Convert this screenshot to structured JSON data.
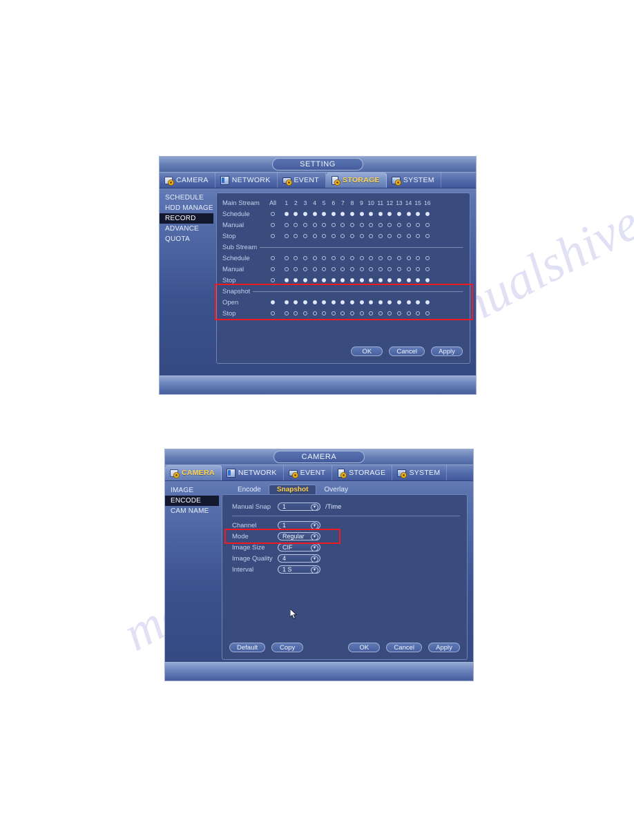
{
  "dialog1": {
    "window_title": "SETTING",
    "tabs": [
      {
        "label": "CAMERA",
        "icon": "camera-icon",
        "active": false
      },
      {
        "label": "NETWORK",
        "icon": "network-icon",
        "active": false
      },
      {
        "label": "EVENT",
        "icon": "event-icon",
        "active": false
      },
      {
        "label": "STORAGE",
        "icon": "storage-icon",
        "active": true
      },
      {
        "label": "SYSTEM",
        "icon": "system-icon",
        "active": false
      }
    ],
    "sidebar": [
      {
        "label": "SCHEDULE",
        "active": false
      },
      {
        "label": "HDD MANAGE",
        "active": false
      },
      {
        "label": "RECORD",
        "active": true
      },
      {
        "label": "ADVANCE",
        "active": false
      },
      {
        "label": "QUOTA",
        "active": false
      }
    ],
    "channel_headers": [
      "1",
      "2",
      "3",
      "4",
      "5",
      "6",
      "7",
      "8",
      "9",
      "10",
      "11",
      "12",
      "13",
      "14",
      "15",
      "16"
    ],
    "all_label": "All",
    "groups": [
      {
        "title": "Main Stream",
        "title_inline": true,
        "rows": [
          {
            "label": "Schedule",
            "all": false,
            "states": [
              true,
              true,
              true,
              true,
              true,
              true,
              true,
              true,
              true,
              true,
              true,
              true,
              true,
              true,
              true,
              true
            ]
          },
          {
            "label": "Manual",
            "all": false,
            "states": [
              false,
              false,
              false,
              false,
              false,
              false,
              false,
              false,
              false,
              false,
              false,
              false,
              false,
              false,
              false,
              false
            ]
          },
          {
            "label": "Stop",
            "all": false,
            "states": [
              false,
              false,
              false,
              false,
              false,
              false,
              false,
              false,
              false,
              false,
              false,
              false,
              false,
              false,
              false,
              false
            ]
          }
        ]
      },
      {
        "title": "Sub Stream",
        "title_inline": false,
        "rows": [
          {
            "label": "Schedule",
            "all": false,
            "states": [
              false,
              false,
              false,
              false,
              false,
              false,
              false,
              false,
              false,
              false,
              false,
              false,
              false,
              false,
              false,
              false
            ]
          },
          {
            "label": "Manual",
            "all": false,
            "states": [
              false,
              false,
              false,
              false,
              false,
              false,
              false,
              false,
              false,
              false,
              false,
              false,
              false,
              false,
              false,
              false
            ]
          },
          {
            "label": "Stop",
            "all": false,
            "states": [
              true,
              true,
              true,
              true,
              true,
              true,
              true,
              true,
              true,
              true,
              true,
              true,
              true,
              true,
              true,
              true
            ]
          }
        ]
      },
      {
        "title": "Snapshot",
        "title_inline": false,
        "rows": [
          {
            "label": "Open",
            "all": true,
            "states": [
              true,
              true,
              true,
              true,
              true,
              true,
              true,
              true,
              true,
              true,
              true,
              true,
              true,
              true,
              true,
              true
            ]
          },
          {
            "label": "Stop",
            "all": false,
            "states": [
              false,
              false,
              false,
              false,
              false,
              false,
              false,
              false,
              false,
              false,
              false,
              false,
              false,
              false,
              false,
              false
            ]
          }
        ]
      }
    ],
    "buttons": [
      {
        "label": "OK"
      },
      {
        "label": "Cancel"
      },
      {
        "label": "Apply"
      }
    ],
    "highlight_color": "#ee1c20"
  },
  "dialog2": {
    "window_title": "CAMERA",
    "tabs": [
      {
        "label": "CAMERA",
        "icon": "camera-icon",
        "active": true
      },
      {
        "label": "NETWORK",
        "icon": "network-icon",
        "active": false
      },
      {
        "label": "EVENT",
        "icon": "event-icon",
        "active": false
      },
      {
        "label": "STORAGE",
        "icon": "storage-icon",
        "active": false
      },
      {
        "label": "SYSTEM",
        "icon": "system-icon",
        "active": false
      }
    ],
    "sidebar": [
      {
        "label": "IMAGE",
        "active": false
      },
      {
        "label": "ENCODE",
        "active": true
      },
      {
        "label": "CAM NAME",
        "active": false
      }
    ],
    "subtabs": [
      {
        "label": "Encode",
        "active": false
      },
      {
        "label": "Snapshot",
        "active": true
      },
      {
        "label": "Overlay",
        "active": false
      }
    ],
    "fields_top": [
      {
        "label": "Manual Snap",
        "value": "1",
        "suffix": "/Time"
      }
    ],
    "fields": [
      {
        "label": "Channel",
        "value": "1"
      },
      {
        "label": "Mode",
        "value": "Regular"
      },
      {
        "label": "Image Size",
        "value": "CIF"
      },
      {
        "label": "Image Quality",
        "value": "4"
      },
      {
        "label": "Interval",
        "value": "1 S"
      }
    ],
    "buttons_left": [
      {
        "label": "Default"
      },
      {
        "label": "Copy"
      }
    ],
    "buttons_right": [
      {
        "label": "OK"
      },
      {
        "label": "Cancel"
      },
      {
        "label": "Apply"
      }
    ],
    "highlight_color": "#ee1c20"
  },
  "watermark": {
    "line1": "manualshive.com",
    "line2": "manualshive.com"
  }
}
